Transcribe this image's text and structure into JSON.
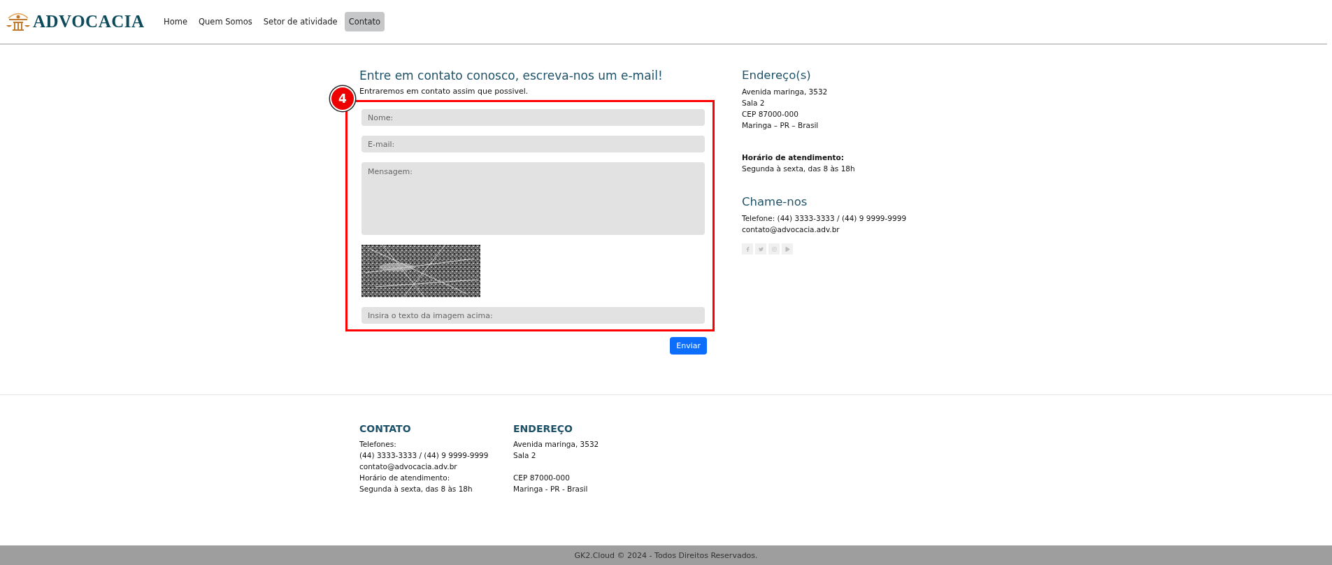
{
  "header": {
    "logo_text": "ADVOCACIA",
    "nav": [
      {
        "label": "Home",
        "selected": false
      },
      {
        "label": "Quem Somos",
        "selected": false
      },
      {
        "label": "Setor de atividade",
        "selected": false
      },
      {
        "label": "Contato",
        "selected": true
      }
    ]
  },
  "contact_form": {
    "title": "Entre em contato conosco, escreva-nos um e-mail!",
    "subtitle": "Entraremos em contato assim que possivel.",
    "annotation": {
      "label": "4"
    },
    "fields": [
      {
        "kind": "input",
        "placeholder": "Nome:"
      },
      {
        "kind": "input",
        "placeholder": "E-mail:"
      },
      {
        "kind": "textarea",
        "placeholder": "Mensagem:"
      },
      {
        "kind": "picture"
      },
      {
        "kind": "input",
        "placeholder": "Insira o texto da imagem acima:"
      }
    ],
    "submit": "Enviar"
  },
  "sidebar": {
    "address_title": "Endereço(s)",
    "address_lines": [
      "Avenida maringa, 3532",
      "Sala 2",
      "CEP 87000-000",
      "Maringa – PR – Brasil"
    ],
    "hours_label": "Horário de atendimento:",
    "hours": "Segunda à sexta, das 8 às 18h",
    "call_title": "Chame-nos",
    "phone": "Telefone: (44) 3333-3333 / (44) 9 9999-9999",
    "email": "contato@advocacia.adv.br",
    "social": [
      {
        "kind": "facebook"
      },
      {
        "kind": "twitter"
      },
      {
        "kind": "instagram"
      },
      {
        "kind": "play"
      }
    ]
  },
  "footer": {
    "columns": [
      {
        "title": "CONTATO",
        "groups": [
          [
            "Telefones:",
            "(44) 3333-3333 / (44) 9 9999-9999",
            "contato@advocacia.adv.br",
            "Horário de atendimento:",
            "Segunda à sexta, das 8 às 18h"
          ]
        ]
      },
      {
        "title": "ENDEREÇO",
        "groups": [
          [
            "Avenida maringa, 3532",
            "Sala 2"
          ],
          [
            "CEP 87000-000",
            "Maringa - PR - Brasil"
          ]
        ]
      }
    ],
    "copyright": "GK2.Cloud © 2024 - Todos Direitos Reservados."
  }
}
